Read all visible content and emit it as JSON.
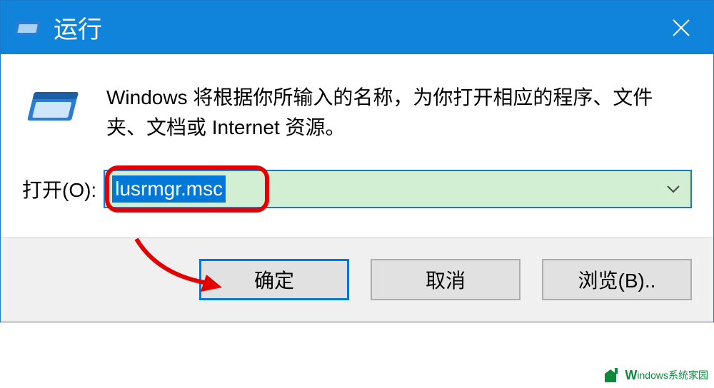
{
  "titlebar": {
    "title": "运行"
  },
  "content": {
    "description": "Windows 将根据你所输入的名称，为你打开相应的程序、文件夹、文档或 Internet 资源。",
    "open_label": "打开(O):",
    "open_value": "lusrmgr.msc"
  },
  "buttons": {
    "ok": "确定",
    "cancel": "取消",
    "browse": "浏览(B).."
  },
  "watermark": {
    "text": "indows系统家园",
    "prefix": "W"
  }
}
